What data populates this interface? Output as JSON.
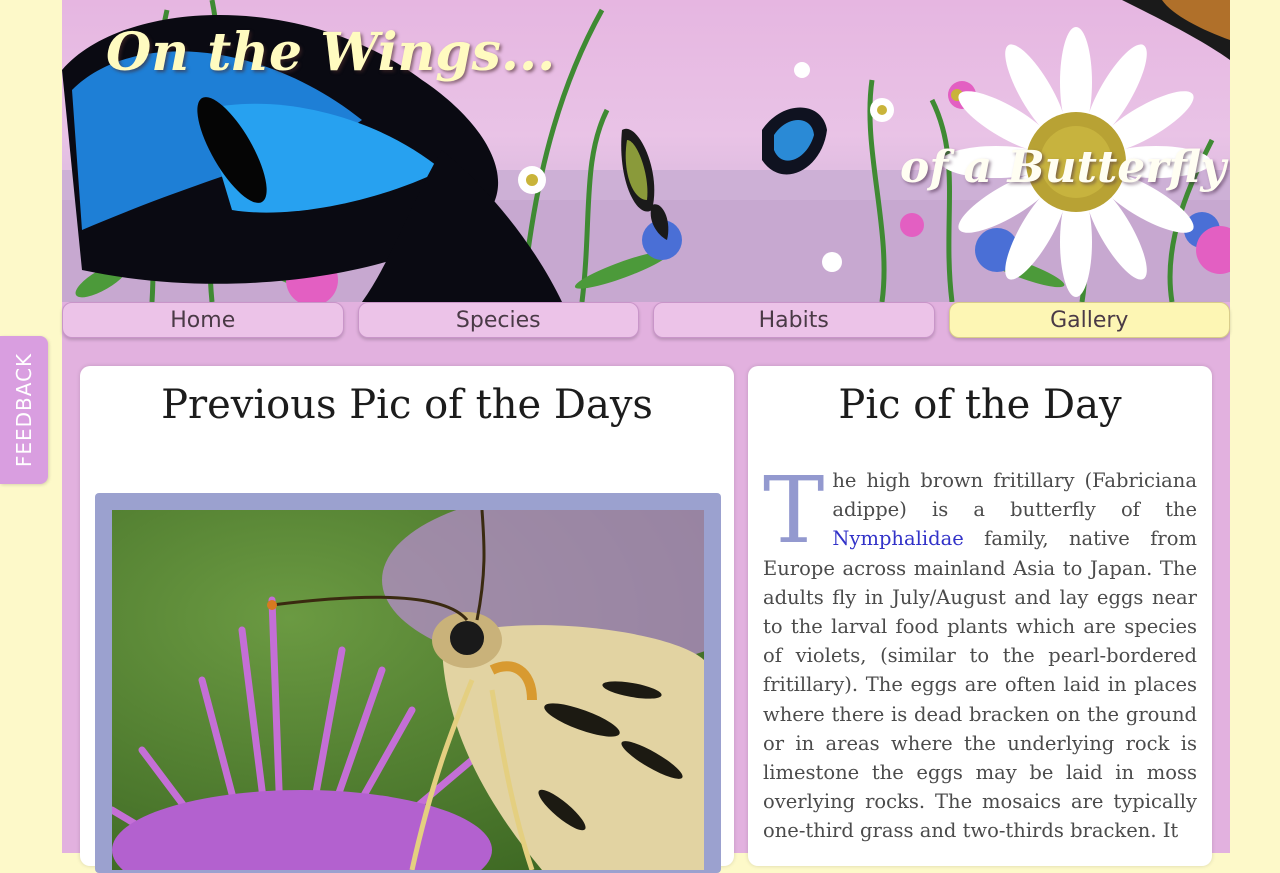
{
  "feedback": {
    "label": "FEEDBACK"
  },
  "banner": {
    "title_left": "On the Wings...",
    "title_right": "of a Butterfly"
  },
  "nav": {
    "tabs": [
      {
        "label": "Home",
        "active": false
      },
      {
        "label": "Species",
        "active": false
      },
      {
        "label": "Habits",
        "active": false
      },
      {
        "label": "Gallery",
        "active": true
      }
    ]
  },
  "previous": {
    "heading": "Previous Pic of the Days"
  },
  "potd": {
    "heading": "Pic of the Day",
    "dropcap": "T",
    "text_before_link": "he high brown fritillary (Fabriciana adippe) is a butterfly of the ",
    "link": "Nymphalidae",
    "text_after_link": " family, native from Europe across mainland Asia to Japan. The adults fly in July/August and lay eggs near to the larval food plants which are species of violets, (similar to the pearl-bordered fritillary). The eggs are often laid in places where there is dead bracken on the ground or in areas where the underlying rock is limestone the eggs may be laid in moss overlying rocks. The mosaics are typically one-third grass and two-thirds bracken. It"
  },
  "colors": {
    "page_bg": "#fdf9c9",
    "container": "#e2b1df",
    "nav_tab": "#ecc3e8",
    "nav_active": "#fdf6b4",
    "link": "#3232c8",
    "dropcap": "#9399cf"
  }
}
